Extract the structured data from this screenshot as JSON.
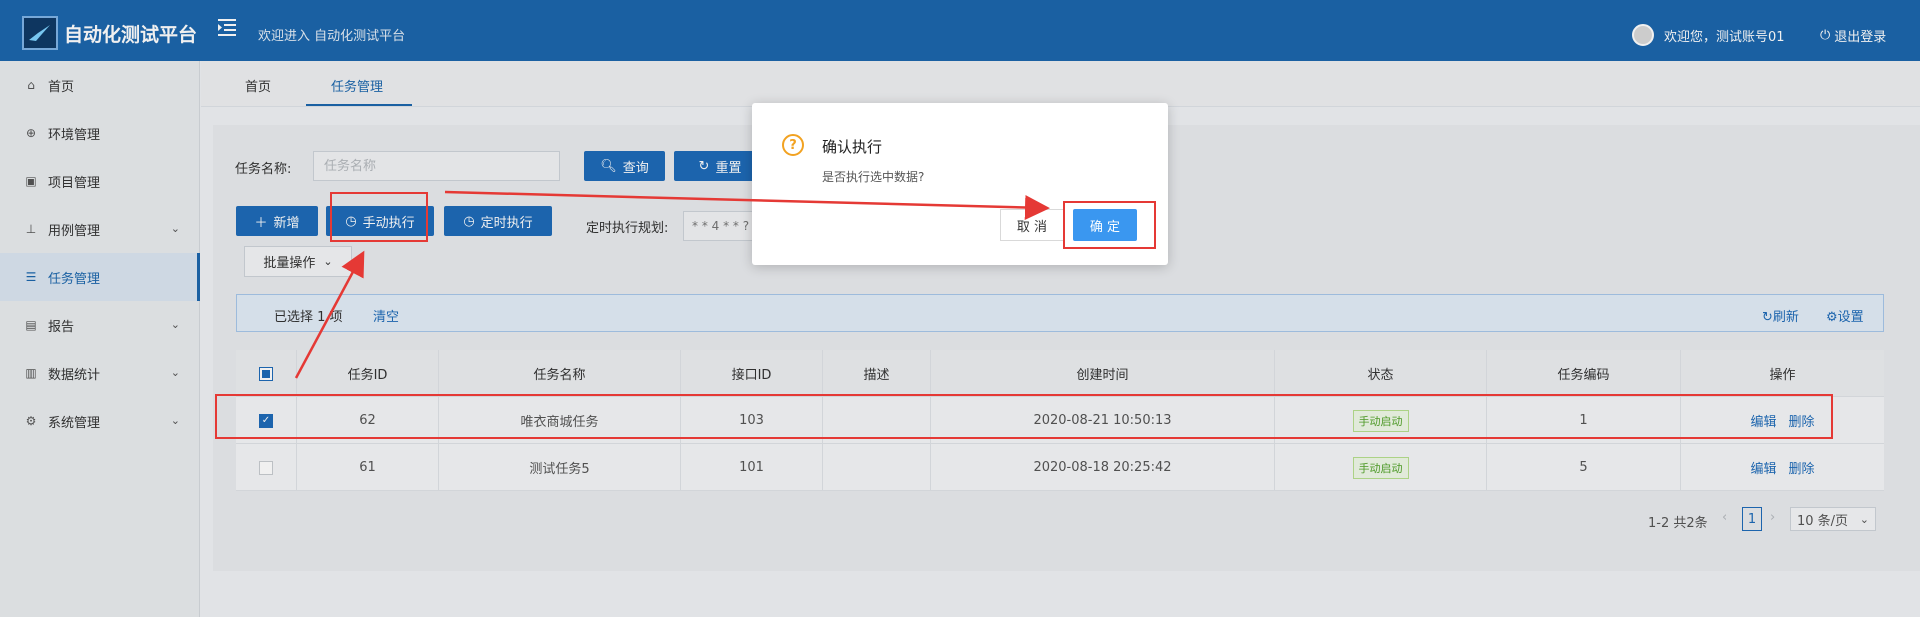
{
  "header": {
    "app_title": "自动化测试平台",
    "welcome": "欢迎进入 自动化测试平台",
    "user_greeting": "欢迎您，测试账号01",
    "logout_label": "退出登录"
  },
  "sidebar": {
    "items": [
      {
        "label": "首页",
        "icon": "home-icon"
      },
      {
        "label": "环境管理",
        "icon": "globe-icon"
      },
      {
        "label": "项目管理",
        "icon": "project-icon"
      },
      {
        "label": "用例管理",
        "icon": "sitemap-icon",
        "expandable": true
      },
      {
        "label": "任务管理",
        "icon": "list-icon",
        "active": true
      },
      {
        "label": "报告",
        "icon": "report-icon",
        "expandable": true
      },
      {
        "label": "数据统计",
        "icon": "bar-chart-icon",
        "expandable": true
      },
      {
        "label": "系统管理",
        "icon": "gear-icon",
        "expandable": true
      }
    ]
  },
  "tabs": [
    {
      "label": "首页"
    },
    {
      "label": "任务管理",
      "active": true
    }
  ],
  "search": {
    "label": "任务名称:",
    "placeholder": "任务名称",
    "query_label": "查询",
    "reset_label": "重置"
  },
  "toolbar": {
    "add_label": "新增",
    "manual_run_label": "手动执行",
    "scheduled_run_label": "定时执行",
    "cron_label": "定时执行规划:",
    "cron_placeholder": "* * 4 * * ?",
    "batch_label": "批量操作"
  },
  "selection": {
    "selected_text": "已选择 1 项",
    "clear_label": "清空",
    "refresh_label": "刷新",
    "settings_label": "设置"
  },
  "table": {
    "columns": [
      "任务ID",
      "任务名称",
      "接口ID",
      "描述",
      "创建时间",
      "状态",
      "任务编码",
      "操作"
    ],
    "rows": [
      {
        "checked": true,
        "id": "62",
        "name": "唯衣商城任务",
        "api_id": "103",
        "desc": "",
        "created": "2020-08-21 10:50:13",
        "status": "手动启动",
        "code": "1",
        "edit": "编辑",
        "delete": "删除"
      },
      {
        "checked": false,
        "id": "61",
        "name": "测试任务5",
        "api_id": "101",
        "desc": "",
        "created": "2020-08-18 20:25:42",
        "status": "手动启动",
        "code": "5",
        "edit": "编辑",
        "delete": "删除"
      }
    ]
  },
  "pagination": {
    "total": "1-2 共2条",
    "current": "1",
    "page_size": "10 条/页"
  },
  "dialog": {
    "title": "确认执行",
    "content": "是否执行选中数据?",
    "cancel_label": "取 消",
    "ok_label": "确 定"
  },
  "colors": {
    "header": "#1c67ad",
    "primary": "#1e6bb8",
    "dialog_ok": "#3a97f0",
    "warning": "#f2a221",
    "annotation": "#e53935",
    "status_green": "#52a32a"
  }
}
